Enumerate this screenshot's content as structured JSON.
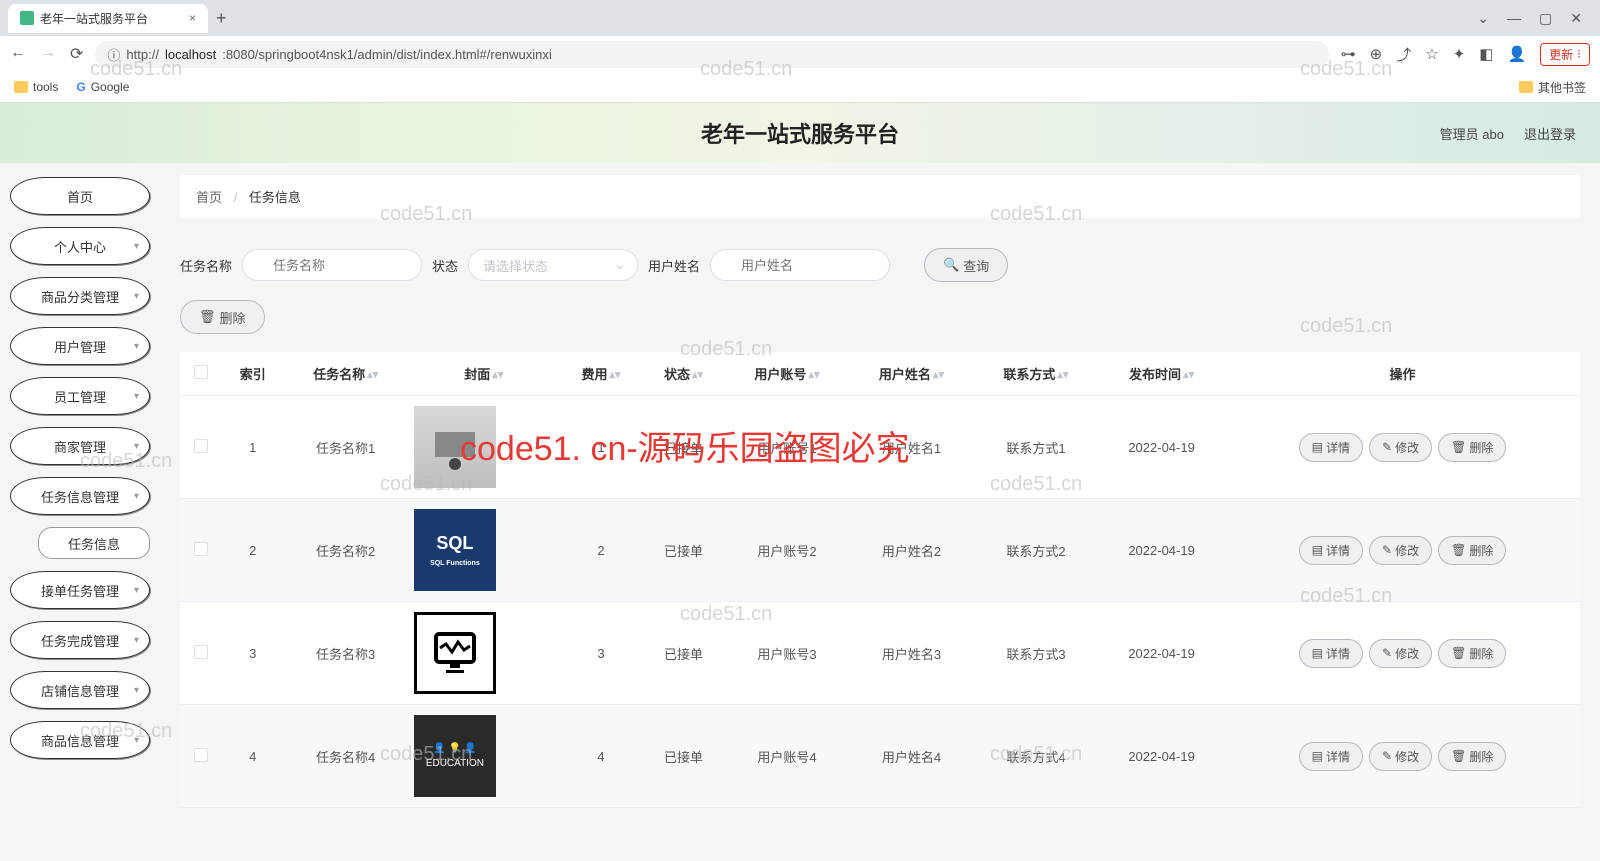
{
  "browser": {
    "tab_title": "老年一站式服务平台",
    "url_protocol": "http://",
    "url_host": "localhost",
    "url_path": ":8080/springboot4nsk1/admin/dist/index.html#/renwuxinxi",
    "update_label": "更新",
    "bookmarks": {
      "tools": "tools",
      "google": "Google",
      "other": "其他书签"
    }
  },
  "header": {
    "title": "老年一站式服务平台",
    "admin_label": "管理员 abo",
    "logout": "退出登录"
  },
  "sidebar": {
    "items": [
      {
        "label": "首页",
        "expandable": false
      },
      {
        "label": "个人中心",
        "expandable": true
      },
      {
        "label": "商品分类管理",
        "expandable": true
      },
      {
        "label": "用户管理",
        "expandable": true
      },
      {
        "label": "员工管理",
        "expandable": true
      },
      {
        "label": "商家管理",
        "expandable": true
      },
      {
        "label": "任务信息管理",
        "expandable": true
      },
      {
        "label": "任务信息",
        "expandable": false,
        "sub": true
      },
      {
        "label": "接单任务管理",
        "expandable": true
      },
      {
        "label": "任务完成管理",
        "expandable": true
      },
      {
        "label": "店铺信息管理",
        "expandable": true
      },
      {
        "label": "商品信息管理",
        "expandable": true
      }
    ]
  },
  "breadcrumb": {
    "home": "首页",
    "current": "任务信息"
  },
  "filters": {
    "name_label": "任务名称",
    "name_placeholder": "任务名称",
    "status_label": "状态",
    "status_placeholder": "请选择状态",
    "user_label": "用户姓名",
    "user_placeholder": "用户姓名",
    "query_btn": "查询"
  },
  "buttons": {
    "delete": "删除",
    "detail": "详情",
    "edit": "修改",
    "row_delete": "删除"
  },
  "table": {
    "headers": {
      "index": "索引",
      "name": "任务名称",
      "cover": "封面",
      "fee": "费用",
      "status": "状态",
      "account": "用户账号",
      "username": "用户姓名",
      "contact": "联系方式",
      "publish": "发布时间",
      "ops": "操作"
    },
    "rows": [
      {
        "index": "1",
        "name": "任务名称1",
        "fee": "1",
        "status": "已接单",
        "account": "用户账号1",
        "username": "用户姓名1",
        "contact": "联系方式1",
        "publish": "2022-04-19"
      },
      {
        "index": "2",
        "name": "任务名称2",
        "fee": "2",
        "status": "已接单",
        "account": "用户账号2",
        "username": "用户姓名2",
        "contact": "联系方式2",
        "publish": "2022-04-19"
      },
      {
        "index": "3",
        "name": "任务名称3",
        "fee": "3",
        "status": "已接单",
        "account": "用户账号3",
        "username": "用户姓名3",
        "contact": "联系方式3",
        "publish": "2022-04-19"
      },
      {
        "index": "4",
        "name": "任务名称4",
        "fee": "4",
        "status": "已接单",
        "account": "用户账号4",
        "username": "用户姓名4",
        "contact": "联系方式4",
        "publish": "2022-04-19"
      }
    ]
  },
  "watermarks": {
    "text": "code51.cn",
    "overlay": "code51. cn-源码乐园盗图必究"
  }
}
